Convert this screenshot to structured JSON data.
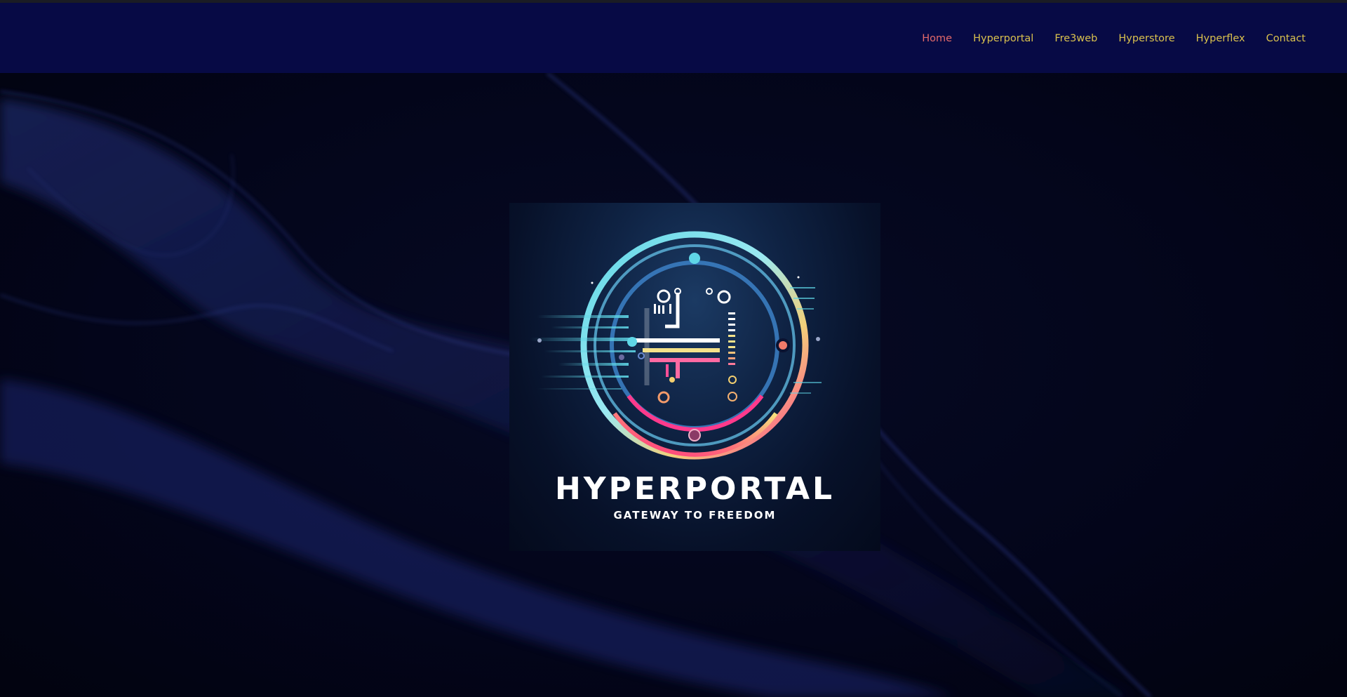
{
  "nav": {
    "items": [
      {
        "label": "Home",
        "active": true
      },
      {
        "label": "Hyperportal",
        "active": false
      },
      {
        "label": "Fre3web",
        "active": false
      },
      {
        "label": "Hyperstore",
        "active": false
      },
      {
        "label": "Hyperflex",
        "active": false
      },
      {
        "label": "Contact",
        "active": false
      }
    ]
  },
  "logo": {
    "title": "HYPERPORTAL",
    "tagline": "GATEWAY TO FREEDOM",
    "icon": "circuit-h-icon"
  },
  "colors": {
    "header_bg": "#070a45",
    "nav_text": "#d9c14e",
    "nav_active": "#e46a6a",
    "page_bg": "#03051a",
    "smoke": "#1f2e7a"
  }
}
